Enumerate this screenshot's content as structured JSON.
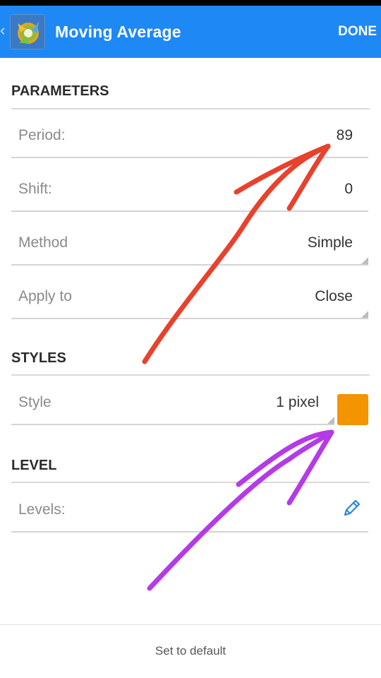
{
  "app_bar": {
    "title": "Moving Average",
    "done_label": "DONE"
  },
  "sections": {
    "parameters": "PARAMETERS",
    "styles": "STYLES",
    "level": "LEVEL"
  },
  "parameters": {
    "period": {
      "label": "Period:",
      "value": "89"
    },
    "shift": {
      "label": "Shift:",
      "value": "0"
    },
    "method": {
      "label": "Method",
      "value": "Simple"
    },
    "apply_to": {
      "label": "Apply to",
      "value": "Close"
    }
  },
  "styles": {
    "style": {
      "label": "Style",
      "value": "1 pixel",
      "color": "#f39400"
    }
  },
  "level": {
    "levels": {
      "label": "Levels:",
      "icon": "pencil-icon"
    }
  },
  "footer": {
    "default_label": "Set to default"
  },
  "colors": {
    "accent": "#1e88f5",
    "annotation_red": "#e8412c",
    "annotation_purple": "#b43be6"
  }
}
